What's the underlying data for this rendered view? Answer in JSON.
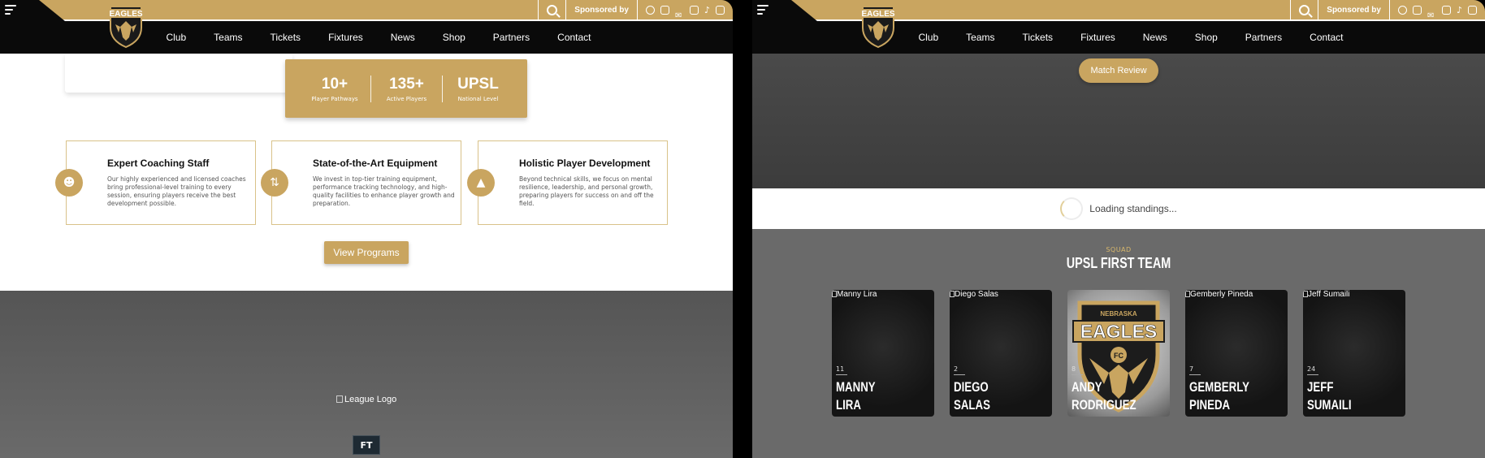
{
  "colors": {
    "gold": "#c9a560",
    "black": "#0a0a0a",
    "dark_gray": "#555555"
  },
  "header": {
    "sponsored_by": "Sponsored by",
    "nav": [
      "Club",
      "Teams",
      "Tickets",
      "Fixtures",
      "News",
      "Shop",
      "Partners",
      "Contact"
    ],
    "socials": [
      "facebook-icon",
      "instagram-icon",
      "twitter-icon",
      "youtube-icon",
      "tiktok-icon",
      "linkedin-icon"
    ],
    "crest_text": "EAGLES"
  },
  "left_page": {
    "stats": [
      {
        "value": "10+",
        "label": "Player Pathways"
      },
      {
        "value": "135+",
        "label": "Active Players"
      },
      {
        "value": "UPSL",
        "label": "National Level"
      }
    ],
    "features": [
      {
        "icon": "user-plus-icon",
        "title": "Expert Coaching Staff",
        "text": "Our highly experienced and licensed coaches bring professional-level training to every session, ensuring players receive the best development possible."
      },
      {
        "icon": "route-icon",
        "title": "State-of-the-Art Equipment",
        "text": "We invest in top-tier training equipment, performance tracking technology, and high-quality facilities to enhance player growth and preparation."
      },
      {
        "icon": "cone-icon",
        "title": "Holistic Player Development",
        "text": "Beyond technical skills, we focus on mental resilience, leadership, and personal growth, preparing players for success on and off the field."
      }
    ],
    "view_programs": "View Programs",
    "league_logo_alt": "League Logo",
    "ft_badge": "FT"
  },
  "right_page": {
    "match_review": "Match Review",
    "standings_loading": "Loading standings...",
    "squad_kicker": "SQUAD",
    "squad_title": "UPSL FIRST TEAM",
    "players": [
      {
        "alt": "Manny Lira",
        "number": "11",
        "first": "MANNY",
        "last": "LIRA"
      },
      {
        "alt": "Diego Salas",
        "number": "2",
        "first": "DIEGO",
        "last": "SALAS"
      },
      {
        "alt": "",
        "number": "8",
        "first": "ANDY",
        "last": "RODRIGUEZ"
      },
      {
        "alt": "Gemberly Pineda",
        "number": "7",
        "first": "GEMBERLY",
        "last": "PINEDA"
      },
      {
        "alt": "Jeff Sumaili",
        "number": "24",
        "first": "JEFF",
        "last": "SUMAILI"
      }
    ],
    "crest": {
      "top": "NEBRASKA",
      "name": "EAGLES",
      "sub": "FC"
    }
  }
}
